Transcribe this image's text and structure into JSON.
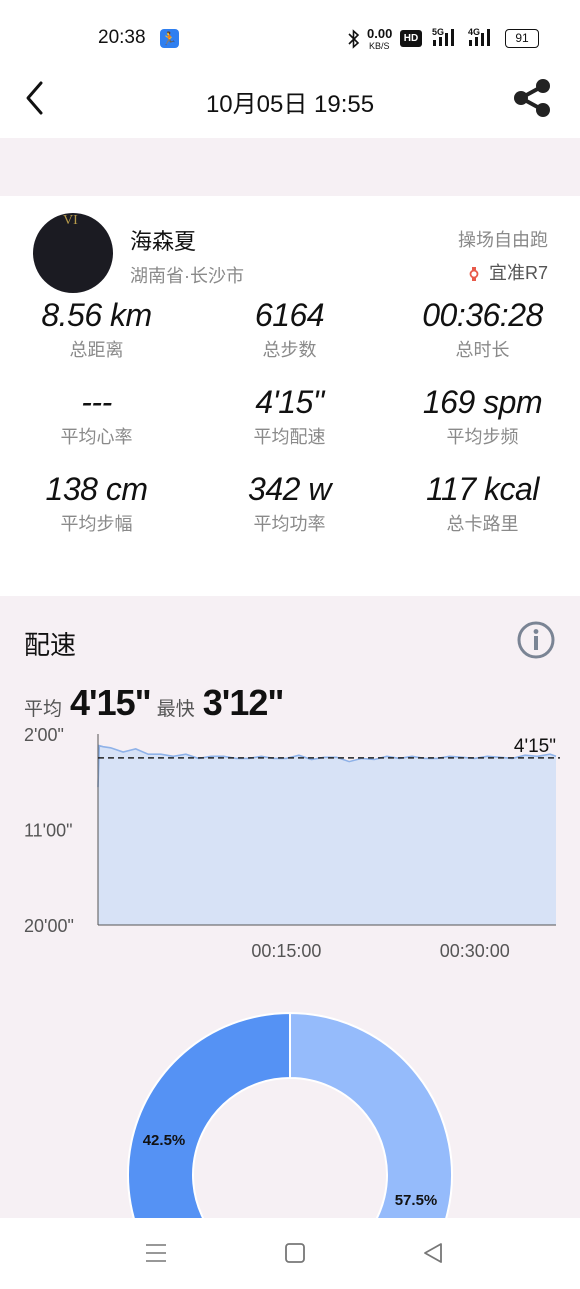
{
  "status_bar": {
    "time": "20:38",
    "network_speed": "0.00",
    "network_unit": "KB/S",
    "hd_badge": "HD",
    "signal1": "5G",
    "signal2": "4G",
    "battery": "91"
  },
  "header": {
    "title": "10月05日 19:55",
    "back_icon": "chevron-left-icon",
    "share_icon": "share-icon"
  },
  "user": {
    "name": "海森夏",
    "location": "湖南省·长沙市",
    "avatar_mark": "VI",
    "run_type": "操场自由跑",
    "device": "宜准R7"
  },
  "stats": [
    {
      "value": "8.56 km",
      "label": "总距离"
    },
    {
      "value": "6164",
      "label": "总步数"
    },
    {
      "value": "00:36:28",
      "label": "总时长"
    },
    {
      "value": "---",
      "label": "平均心率"
    },
    {
      "value": "4'15\"",
      "label": "平均配速"
    },
    {
      "value": "169 spm",
      "label": "平均步频"
    },
    {
      "value": "138 cm",
      "label": "平均步幅"
    },
    {
      "value": "342 w",
      "label": "平均功率"
    },
    {
      "value": "117 kcal",
      "label": "总卡路里"
    }
  ],
  "pace": {
    "title": "配速",
    "avg_label": "平均",
    "avg_value": "4'15\"",
    "fast_label": "最快",
    "fast_value": "3'12\"",
    "info_icon": "info-icon"
  },
  "chart_data": [
    {
      "type": "area",
      "y_tick_labels": [
        "2'00\"",
        "11'00\"",
        "20'00\""
      ],
      "y_ticks_min_per_km": [
        2,
        11,
        20
      ],
      "ylim": [
        2,
        20
      ],
      "y_inverted": true,
      "x_tick_labels": [
        "00:15:00",
        "00:30:00"
      ],
      "x_ticks_min": [
        15,
        30
      ],
      "xlim": [
        0,
        36.47
      ],
      "reference_line": {
        "label": "4'15\"",
        "value": 4.25
      },
      "series": [
        {
          "x": [
            0,
            0.1,
            0.4,
            1,
            2,
            3,
            4,
            5,
            6,
            7,
            8,
            9,
            10,
            11,
            12,
            13,
            14,
            15,
            16,
            17,
            18,
            19,
            20,
            21,
            22,
            23,
            24,
            25,
            26,
            27,
            28,
            29,
            30,
            31,
            32,
            33,
            34,
            35,
            36,
            36.47
          ],
          "y": [
            7.0,
            3.1,
            3.2,
            3.3,
            3.7,
            3.4,
            3.9,
            3.9,
            4.1,
            3.9,
            4.3,
            4.1,
            4.1,
            4.3,
            4.3,
            4.1,
            4.3,
            4.3,
            4.0,
            4.4,
            4.2,
            4.2,
            4.6,
            4.3,
            4.4,
            4.1,
            4.3,
            4.1,
            4.3,
            4.3,
            4.1,
            4.2,
            4.3,
            4.1,
            4.2,
            4.3,
            4.0,
            4.1,
            3.9,
            4.1
          ]
        }
      ],
      "colors": {
        "line": "#8fb2e8",
        "fill": "#d7e2f6",
        "reference": "#222222"
      }
    },
    {
      "type": "pie",
      "slices": [
        {
          "label": "42.5%",
          "value": 42.5,
          "color": "#5592f4"
        },
        {
          "label": "57.5%",
          "value": 57.5,
          "color": "#95bbfb"
        }
      ]
    }
  ],
  "nav_bar": {
    "menu_icon": "menu-icon",
    "home_icon": "home-square-icon",
    "back_icon": "back-triangle-icon"
  }
}
